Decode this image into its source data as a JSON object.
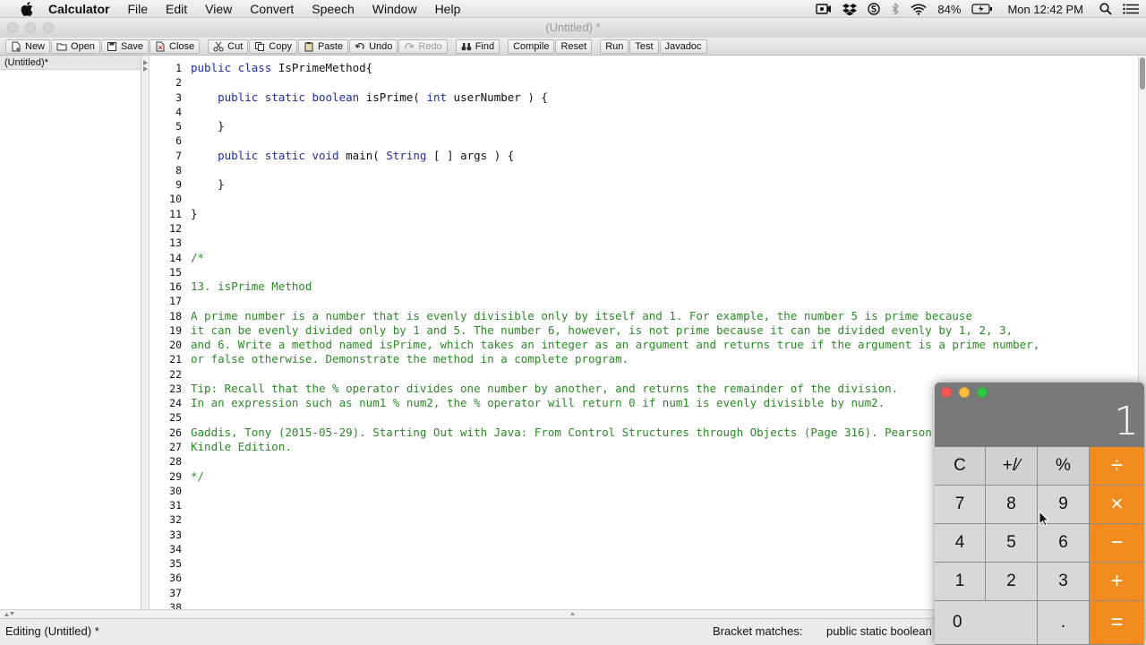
{
  "menubar": {
    "app_name": "Calculator",
    "items": [
      "File",
      "Edit",
      "View",
      "Convert",
      "Speech",
      "Window",
      "Help"
    ],
    "battery": "84%",
    "clock": "Mon 12:42 PM"
  },
  "window": {
    "title": "(Untitled) *"
  },
  "toolbar": {
    "new": "New",
    "open": "Open",
    "save": "Save",
    "close": "Close",
    "cut": "Cut",
    "copy": "Copy",
    "paste": "Paste",
    "undo": "Undo",
    "redo": "Redo",
    "find": "Find",
    "compile": "Compile",
    "reset": "Reset",
    "run": "Run",
    "test": "Test",
    "javadoc": "Javadoc"
  },
  "files_panel": {
    "items": [
      "(Untitled)*"
    ]
  },
  "editor": {
    "lines": [
      "public class IsPrimeMethod{",
      "",
      "    public static boolean isPrime( int userNumber ) {",
      "",
      "    }",
      "",
      "    public static void main( String [ ] args ) {",
      "",
      "    }",
      "",
      "}",
      "",
      "",
      "/*",
      "",
      "13. isPrime Method",
      "",
      "A prime number is a number that is evenly divisible only by itself and 1. For example, the number 5 is prime because",
      "it can be evenly divided only by 1 and 5. The number 6, however, is not prime because it can be divided evenly by 1, 2, 3,",
      "and 6. Write a method named isPrime, which takes an integer as an argument and returns true if the argument is a prime number,",
      "or false otherwise. Demonstrate the method in a complete program.",
      "",
      "Tip: Recall that the % operator divides one number by another, and returns the remainder of the division.",
      "In an expression such as num1 % num2, the % operator will return 0 if num1 is evenly divisible by num2.",
      "",
      "Gaddis, Tony (2015-05-29). Starting Out with Java: From Control Structures through Objects (Page 316). Pearson Education. Kindle Edition.",
      "Kindle Edition.",
      "",
      "*/",
      "",
      "",
      "",
      "",
      "",
      "",
      "",
      "",
      ""
    ]
  },
  "statusbar": {
    "left": "Editing (Untitled) *",
    "bracket_label": "Bracket matches:",
    "bracket_value": "public static boolean isPrime( int userNumber ) {"
  },
  "calculator": {
    "display": "1",
    "keys": [
      "C",
      "+/∕",
      "%",
      "÷",
      "7",
      "8",
      "9",
      "×",
      "4",
      "5",
      "6",
      "−",
      "1",
      "2",
      "3",
      "+",
      "0",
      ".",
      "="
    ]
  },
  "colors": {
    "keyword": "#1c2ea0",
    "comment": "#2a8a25",
    "calc_operator": "#f28c1e"
  }
}
